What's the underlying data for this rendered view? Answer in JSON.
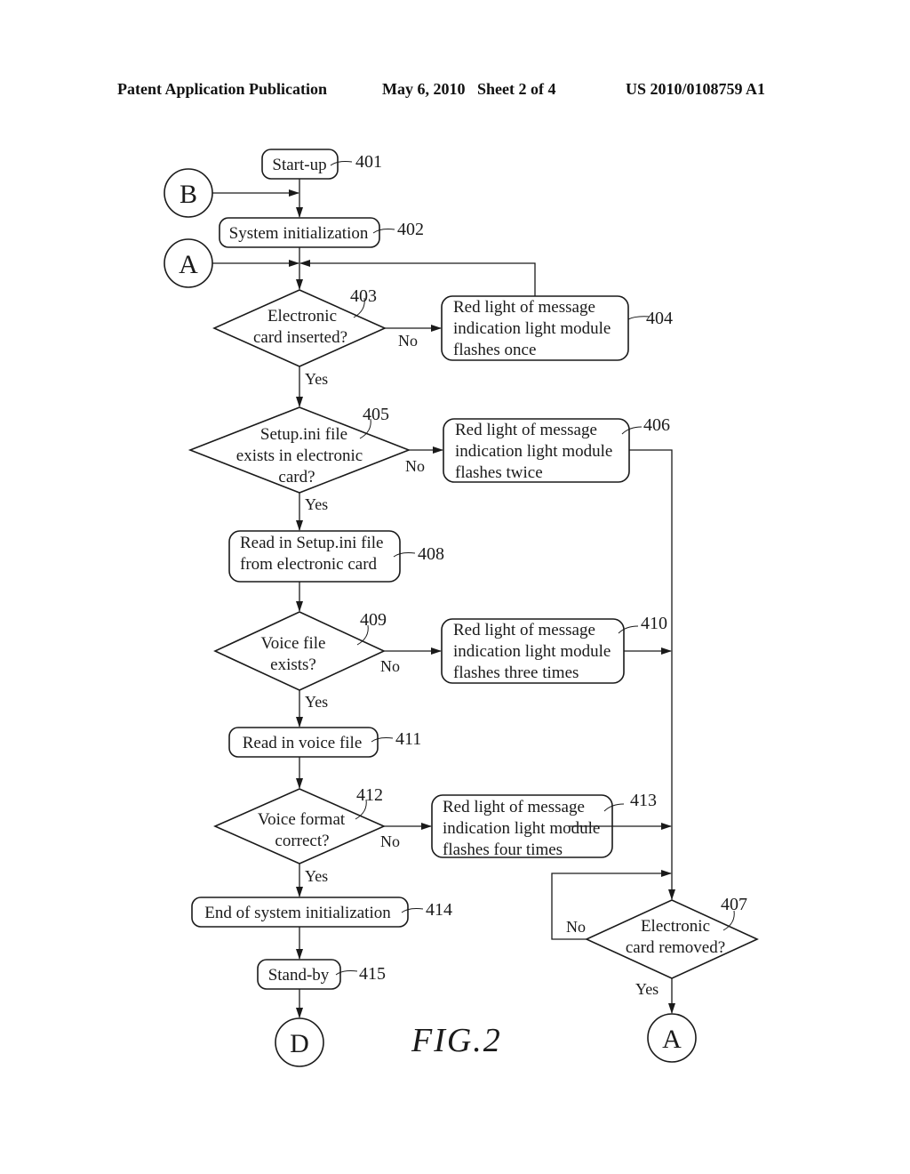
{
  "header": {
    "publication": "Patent Application Publication",
    "date_sheet": "May 6, 2010   Sheet 2 of 4",
    "number": "US 2010/0108759 A1"
  },
  "figure_label": "FIG.2",
  "connectors": {
    "B_top": "B",
    "A_top": "A",
    "D_bottom": "D",
    "A_bottom": "A"
  },
  "nodes": {
    "n401": {
      "ref": "401",
      "lines": [
        "Start-up"
      ]
    },
    "n402": {
      "ref": "402",
      "lines": [
        "System initialization"
      ]
    },
    "n403": {
      "ref": "403",
      "lines": [
        "Electronic",
        "card inserted?"
      ]
    },
    "n404": {
      "ref": "404",
      "lines": [
        "Red light of message",
        "indication light module",
        "flashes once"
      ]
    },
    "n405": {
      "ref": "405",
      "lines": [
        "Setup.ini file",
        "exists in electronic",
        "card?"
      ]
    },
    "n406": {
      "ref": "406",
      "lines": [
        "Red light of message",
        "indication light module",
        "flashes twice"
      ]
    },
    "n407": {
      "ref": "407",
      "lines": [
        "Electronic",
        "card removed?"
      ]
    },
    "n408": {
      "ref": "408",
      "lines": [
        "Read in Setup.ini file",
        "from electronic card"
      ]
    },
    "n409": {
      "ref": "409",
      "lines": [
        "Voice file",
        "exists?"
      ]
    },
    "n410": {
      "ref": "410",
      "lines": [
        "Red light of message",
        "indication light module",
        "flashes three times"
      ]
    },
    "n411": {
      "ref": "411",
      "lines": [
        "Read in voice file"
      ]
    },
    "n412": {
      "ref": "412",
      "lines": [
        "Voice format",
        "correct?"
      ]
    },
    "n413": {
      "ref": "413",
      "lines": [
        "Red light of message",
        "indication light module",
        "flashes four times"
      ]
    },
    "n414": {
      "ref": "414",
      "lines": [
        "End of system initialization"
      ]
    },
    "n415": {
      "ref": "415",
      "lines": [
        "Stand-by"
      ]
    }
  },
  "edge_labels": {
    "yes": "Yes",
    "no": "No"
  }
}
